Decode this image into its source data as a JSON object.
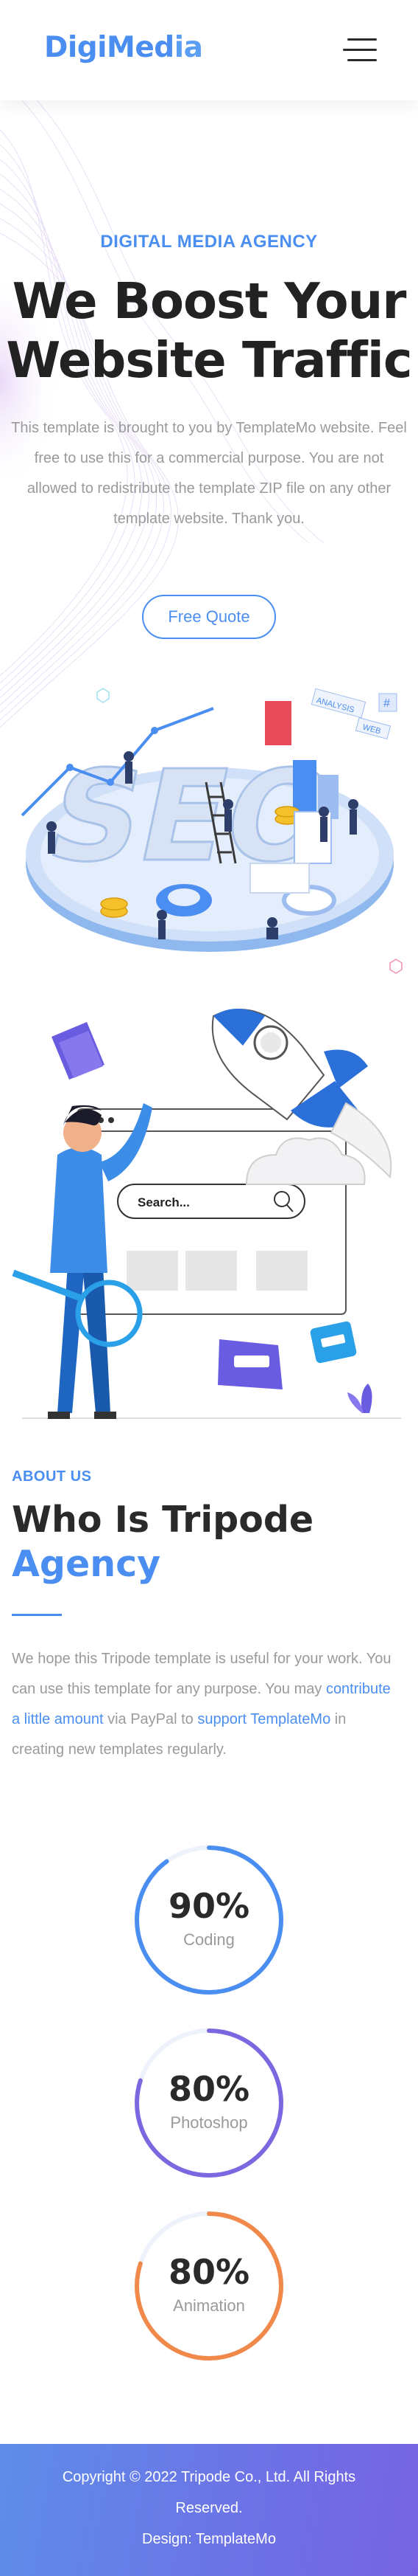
{
  "header": {
    "logo_main": "DigiMed",
    "logo_accent": "ia",
    "menu_icon": "hamburger-menu-icon"
  },
  "hero": {
    "eyebrow": "DIGITAL MEDIA AGENCY",
    "title_line1": "We Boost Your",
    "title_line2": "Website Traffic",
    "text": "This template is brought to you by TemplateMo website. Feel free to use this for a commercial purpose. You are not allowed to redistribute the template ZIP file on any other template website. Thank you.",
    "button": "Free Quote",
    "seo_letters": "SEO",
    "tag_analysis": "ANALYSIS",
    "tag_web": "WEB",
    "tag_hash": "#",
    "search_placeholder": "Search..."
  },
  "about": {
    "eyebrow": "ABOUT US",
    "title_line1": "Who Is Tripode",
    "title_line2": "Agency",
    "text_part1": "We hope this Tripode template is useful for your work. You can use this template for any purpose. You may ",
    "link1": "contribute a little amount",
    "text_part2": " via PayPal to ",
    "link2": "support TemplateMo",
    "text_part3": " in creating new templates regularly.",
    "skills": [
      {
        "percent": "90%",
        "label": "Coding",
        "value": 0.9,
        "color": "#4b8ef1"
      },
      {
        "percent": "80%",
        "label": "Photoshop",
        "value": 0.8,
        "color": "#7b68e0"
      },
      {
        "percent": "80%",
        "label": "Animation",
        "value": 0.8,
        "color": "#f0894a"
      }
    ]
  },
  "footer": {
    "line1": "Copyright © 2022 Tripode Co., Ltd. All Rights",
    "line2": "Reserved.",
    "line3": "Design: TemplateMo"
  },
  "colors": {
    "accent": "#4b8ef1",
    "text_muted": "#9a9a9a",
    "footer_start": "#5d8de8",
    "footer_end": "#7763e2"
  }
}
